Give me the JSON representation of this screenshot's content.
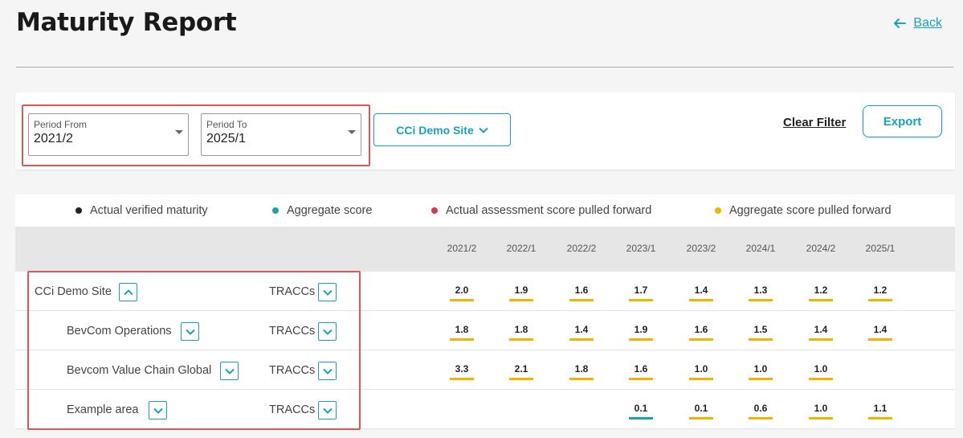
{
  "header": {
    "title": "Maturity Report",
    "back_label": "Back"
  },
  "filters": {
    "period_from": {
      "label": "Period From",
      "value": "2021/2"
    },
    "period_to": {
      "label": "Period To",
      "value": "2025/1"
    },
    "site_button": "CCi Demo Site",
    "clear_filter": "Clear Filter",
    "export": "Export"
  },
  "legend": [
    {
      "label": "Actual verified maturity",
      "color": "#222222"
    },
    {
      "label": "Aggregate score",
      "color": "#1aa3a3"
    },
    {
      "label": "Actual assessment score pulled forward",
      "color": "#e0344d"
    },
    {
      "label": "Aggregate score pulled forward",
      "color": "#f2b300"
    }
  ],
  "periods": [
    "2021/2",
    "2022/1",
    "2022/2",
    "2023/1",
    "2023/2",
    "2024/1",
    "2024/2",
    "2025/1"
  ],
  "colors": {
    "accent": "#17a2b8",
    "pulled_forward_aggregate": "#f2b300",
    "aggregate": "#1aa3a3",
    "highlight": "#e05555"
  },
  "rows": [
    {
      "name": "CCi Demo Site",
      "expanded": true,
      "type": "TRACCs",
      "scores": [
        "2.0",
        "1.9",
        "1.6",
        "1.7",
        "1.4",
        "1.3",
        "1.2",
        "1.2"
      ],
      "kinds": [
        "pf",
        "pf",
        "pf",
        "pf",
        "pf",
        "pf",
        "pf",
        "pf"
      ]
    },
    {
      "name": "BevCom Operations",
      "expanded": false,
      "type": "TRACCs",
      "scores": [
        "1.8",
        "1.8",
        "1.4",
        "1.9",
        "1.6",
        "1.5",
        "1.4",
        "1.4"
      ],
      "kinds": [
        "pf",
        "pf",
        "pf",
        "pf",
        "pf",
        "pf",
        "pf",
        "pf"
      ]
    },
    {
      "name": "Bevcom Value Chain Global",
      "expanded": false,
      "type": "TRACCs",
      "scores": [
        "3.3",
        "2.1",
        "1.8",
        "1.6",
        "1.0",
        "1.0",
        "1.0",
        ""
      ],
      "kinds": [
        "pf",
        "pf",
        "pf",
        "pf",
        "pf",
        "pf",
        "pf",
        ""
      ]
    },
    {
      "name": "Example area",
      "expanded": false,
      "type": "TRACCs",
      "scores": [
        "",
        "",
        "",
        "0.1",
        "0.1",
        "0.6",
        "1.0",
        "1.1"
      ],
      "kinds": [
        "",
        "",
        "",
        "agg",
        "pf",
        "pf",
        "pf",
        "pf"
      ]
    }
  ]
}
